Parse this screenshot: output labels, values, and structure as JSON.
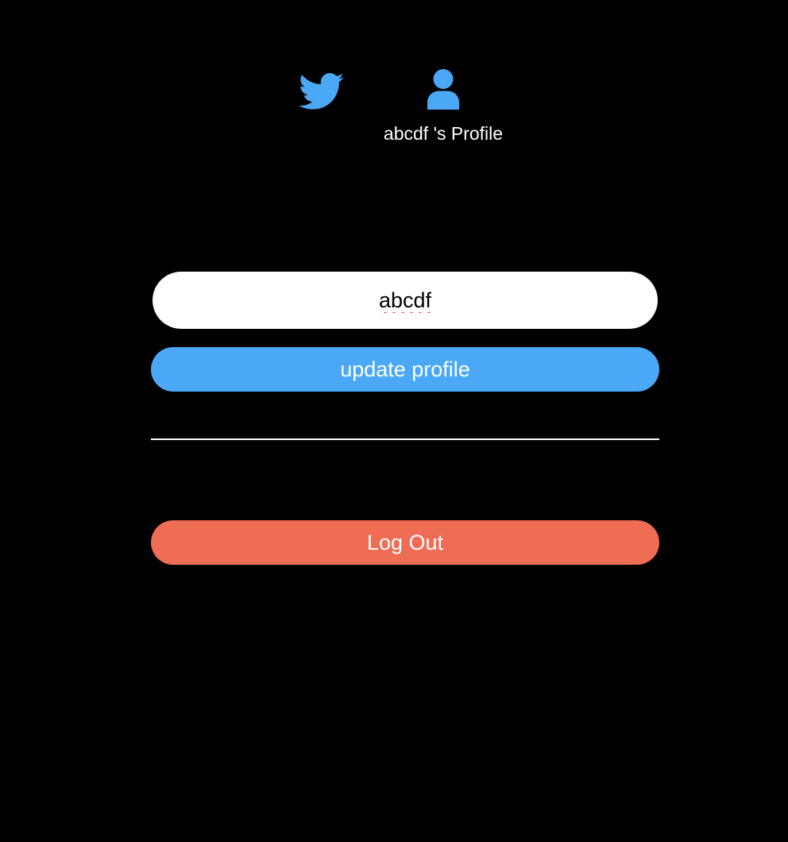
{
  "nav": {
    "home_icon": "twitter-bird-icon",
    "profile_icon": "user-icon",
    "profile_label": "abcdf 's Profile",
    "icon_color": "#4aa8f7"
  },
  "form": {
    "name_value": "abcdf",
    "update_label": "update profile",
    "update_color": "#4aa8f7"
  },
  "logout": {
    "label": "Log Out",
    "color": "#ef6c55"
  }
}
